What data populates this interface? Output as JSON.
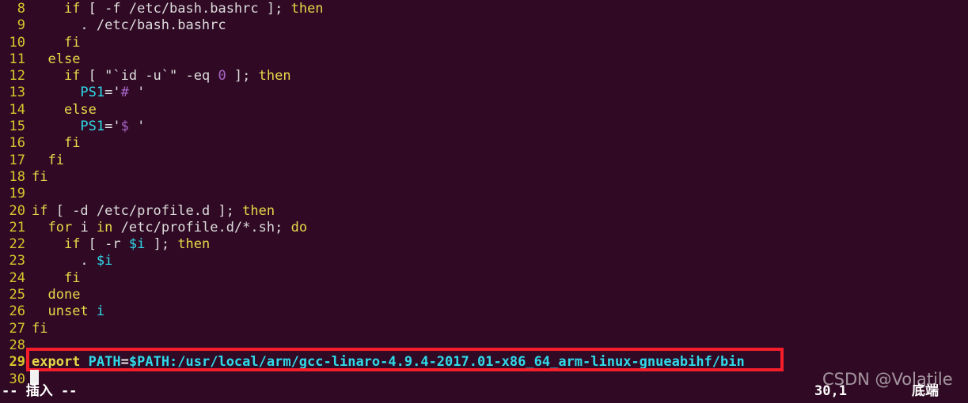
{
  "terminal": {
    "background_color": "#300a24",
    "foreground_color": "#e8e8e8",
    "app": "vim"
  },
  "colors": {
    "keyword": "#e8d84a",
    "identifier": "#2fd9e8",
    "number": "#a865c9",
    "plain": "#e8e8e8",
    "line_number": "#d8c72d",
    "highlight_box": "#f41d2a",
    "cursor": "#f2f2f2",
    "status_text": "#ffffff"
  },
  "editor": {
    "first_visible_line": 8,
    "last_visible_line": 30,
    "lines": [
      {
        "n": "8",
        "tokens": [
          {
            "t": "    ",
            "c": "plain"
          },
          {
            "t": "if",
            "c": "kw"
          },
          {
            "t": " [ ",
            "c": "plain"
          },
          {
            "t": "-f",
            "c": "plain"
          },
          {
            "t": " /etc/bash.bashrc ];",
            "c": "pth"
          },
          {
            "t": " ",
            "c": "plain"
          },
          {
            "t": "then",
            "c": "kw"
          }
        ]
      },
      {
        "n": "9",
        "tokens": [
          {
            "t": "      . /etc/bash.bashrc",
            "c": "pth"
          }
        ]
      },
      {
        "n": "10",
        "tokens": [
          {
            "t": "    ",
            "c": "plain"
          },
          {
            "t": "fi",
            "c": "kw"
          }
        ]
      },
      {
        "n": "11",
        "tokens": [
          {
            "t": "  ",
            "c": "plain"
          },
          {
            "t": "else",
            "c": "kw"
          }
        ]
      },
      {
        "n": "12",
        "tokens": [
          {
            "t": "    ",
            "c": "plain"
          },
          {
            "t": "if",
            "c": "kw"
          },
          {
            "t": " [ \"`id -u`\" -eq ",
            "c": "pth"
          },
          {
            "t": "0",
            "c": "num"
          },
          {
            "t": " ];",
            "c": "pth"
          },
          {
            "t": " ",
            "c": "plain"
          },
          {
            "t": "then",
            "c": "kw"
          }
        ]
      },
      {
        "n": "13",
        "tokens": [
          {
            "t": "      ",
            "c": "plain"
          },
          {
            "t": "PS1",
            "c": "id"
          },
          {
            "t": "=",
            "c": "plain"
          },
          {
            "t": "'",
            "c": "pth"
          },
          {
            "t": "#",
            "c": "num"
          },
          {
            "t": " '",
            "c": "pth"
          }
        ]
      },
      {
        "n": "14",
        "tokens": [
          {
            "t": "    ",
            "c": "plain"
          },
          {
            "t": "else",
            "c": "kw"
          }
        ]
      },
      {
        "n": "15",
        "tokens": [
          {
            "t": "      ",
            "c": "plain"
          },
          {
            "t": "PS1",
            "c": "id"
          },
          {
            "t": "=",
            "c": "plain"
          },
          {
            "t": "'",
            "c": "pth"
          },
          {
            "t": "$",
            "c": "num"
          },
          {
            "t": " '",
            "c": "pth"
          }
        ]
      },
      {
        "n": "16",
        "tokens": [
          {
            "t": "    ",
            "c": "plain"
          },
          {
            "t": "fi",
            "c": "kw"
          }
        ]
      },
      {
        "n": "17",
        "tokens": [
          {
            "t": "  ",
            "c": "plain"
          },
          {
            "t": "fi",
            "c": "kw"
          }
        ]
      },
      {
        "n": "18",
        "tokens": [
          {
            "t": "fi",
            "c": "kw"
          }
        ]
      },
      {
        "n": "19",
        "tokens": [
          {
            "t": "",
            "c": "plain"
          }
        ]
      },
      {
        "n": "20",
        "tokens": [
          {
            "t": "if",
            "c": "kw"
          },
          {
            "t": " [ -d /etc/profile.d ];",
            "c": "pth"
          },
          {
            "t": " ",
            "c": "plain"
          },
          {
            "t": "then",
            "c": "kw"
          }
        ]
      },
      {
        "n": "21",
        "tokens": [
          {
            "t": "  ",
            "c": "plain"
          },
          {
            "t": "for",
            "c": "kw"
          },
          {
            "t": " i ",
            "c": "plain"
          },
          {
            "t": "in",
            "c": "kw"
          },
          {
            "t": " /etc/profile.d/*.sh;",
            "c": "pth"
          },
          {
            "t": " ",
            "c": "plain"
          },
          {
            "t": "do",
            "c": "kw"
          }
        ]
      },
      {
        "n": "22",
        "tokens": [
          {
            "t": "    ",
            "c": "plain"
          },
          {
            "t": "if",
            "c": "kw"
          },
          {
            "t": " [ -r ",
            "c": "pth"
          },
          {
            "t": "$i",
            "c": "id"
          },
          {
            "t": " ];",
            "c": "pth"
          },
          {
            "t": " ",
            "c": "plain"
          },
          {
            "t": "then",
            "c": "kw"
          }
        ]
      },
      {
        "n": "23",
        "tokens": [
          {
            "t": "      . ",
            "c": "pth"
          },
          {
            "t": "$i",
            "c": "id"
          }
        ]
      },
      {
        "n": "24",
        "tokens": [
          {
            "t": "    ",
            "c": "plain"
          },
          {
            "t": "fi",
            "c": "kw"
          }
        ]
      },
      {
        "n": "25",
        "tokens": [
          {
            "t": "  ",
            "c": "plain"
          },
          {
            "t": "done",
            "c": "kw"
          }
        ]
      },
      {
        "n": "26",
        "tokens": [
          {
            "t": "  ",
            "c": "plain"
          },
          {
            "t": "unset",
            "c": "kw"
          },
          {
            "t": " ",
            "c": "plain"
          },
          {
            "t": "i",
            "c": "id"
          }
        ]
      },
      {
        "n": "27",
        "tokens": [
          {
            "t": "fi",
            "c": "kw"
          }
        ]
      },
      {
        "n": "28",
        "tokens": [
          {
            "t": "",
            "c": "plain"
          }
        ]
      },
      {
        "n": "29",
        "bold": true,
        "tokens": [
          {
            "t": "export",
            "c": "kw"
          },
          {
            "t": " ",
            "c": "plain"
          },
          {
            "t": "PATH",
            "c": "idb"
          },
          {
            "t": "=",
            "c": "plain"
          },
          {
            "t": "$PATH:/usr/local/arm/gcc-linaro-4.9.4-2017.01-x86_64_arm-linux-gnueabihf/bin",
            "c": "idb"
          }
        ]
      },
      {
        "n": "30",
        "tokens": [
          {
            "t": "",
            "c": "plain"
          }
        ]
      }
    ]
  },
  "annotation": {
    "highlight_target_line": "29",
    "highlight_text": "export PATH=$PATH:/usr/local/arm/gcc-linaro-4.9.4-2017.01-x86_64_arm-linux-gnueabihf/bin"
  },
  "status_bar": {
    "mode": "-- 插入 --",
    "ruler": "30,1",
    "file_position": "底端"
  },
  "watermark": {
    "text": "CSDN @Volatile"
  }
}
